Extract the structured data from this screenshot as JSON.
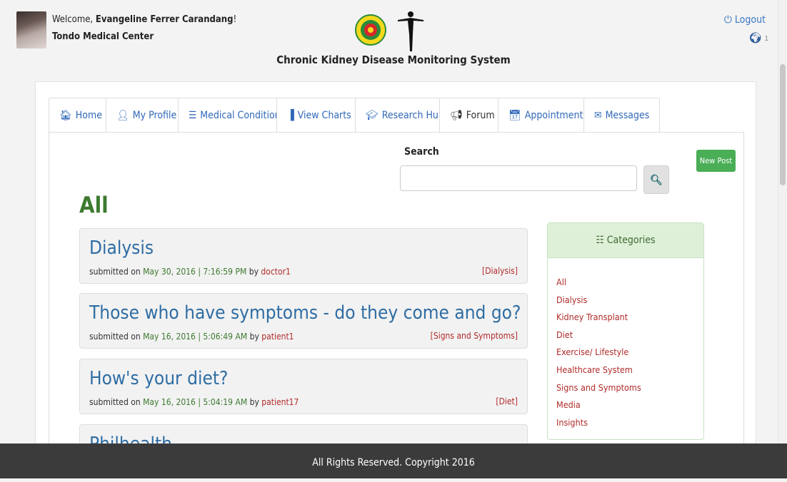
{
  "header": {
    "welcome_prefix": "Welcome, ",
    "user_name": "Evangeline Ferrer Carandang",
    "welcome_suffix": "!",
    "organization": "Tondo Medical Center",
    "system_title": "Chronic Kidney Disease Monitoring System",
    "logout_label": "Logout",
    "notification_count": "1"
  },
  "tabs": [
    {
      "label": "Home",
      "icon": "home-icon"
    },
    {
      "label": "My Profile",
      "icon": "user-icon"
    },
    {
      "label": "Medical Condition",
      "icon": "list-icon"
    },
    {
      "label": "View Charts",
      "icon": "bar-chart-icon"
    },
    {
      "label": "Research Hub",
      "icon": "graduation-cap-icon"
    },
    {
      "label": "Forum",
      "icon": "megaphone-icon",
      "active": true
    },
    {
      "label": "Appointments",
      "icon": "calendar-icon"
    },
    {
      "label": "Messages",
      "icon": "envelope-icon"
    }
  ],
  "search": {
    "label": "Search",
    "value": ""
  },
  "new_post_label": "New Post",
  "heading": "All",
  "posts": [
    {
      "title": "Dialysis",
      "prefix": "submitted on ",
      "date": "May 30, 2016 | 7:16:59 PM",
      "by": " by ",
      "author": "doctor1",
      "category": "[Dialysis]"
    },
    {
      "title": "Those who have symptoms - do they come and go?",
      "prefix": "submitted on ",
      "date": "May 16, 2016 | 5:06:49 AM",
      "by": " by ",
      "author": "patient1",
      "category": "[Signs and Symptoms]"
    },
    {
      "title": "How's your diet?",
      "prefix": "submitted on ",
      "date": "May 16, 2016 | 5:04:19 AM",
      "by": " by ",
      "author": "patient17",
      "category": "[Diet]"
    },
    {
      "title": "Philhealth"
    }
  ],
  "categories": {
    "title": "Categories",
    "items": [
      "All",
      "Dialysis",
      "Kidney Transplant",
      "Diet",
      "Exercise/ Lifestyle",
      "Healthcare System",
      "Signs and Symptoms",
      "Media",
      "Insights"
    ]
  },
  "footer": {
    "text": "All Rights Reserved. Copyright 2016"
  },
  "colors": {
    "link_blue": "#2e6da4",
    "heading_green": "#3d7a30",
    "author_red": "#b12a2a",
    "button_green": "#4aae56",
    "footer_bg": "#3b3b3b"
  }
}
